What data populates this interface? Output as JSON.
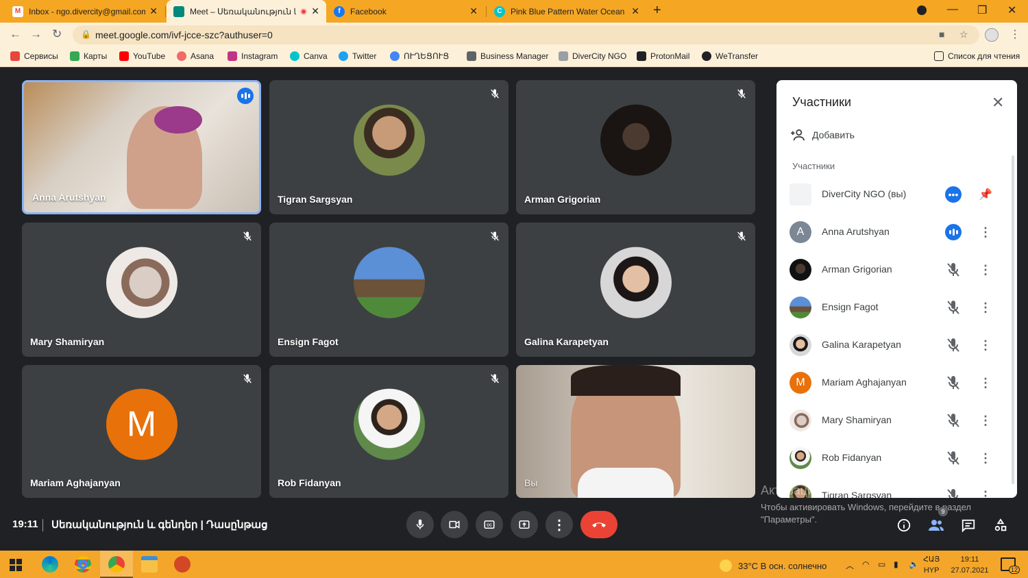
{
  "browser": {
    "tabs": [
      {
        "title": "Inbox - ngo.divercity@gmail.com",
        "favicon": "gmail-icon",
        "color": "#ea4335"
      },
      {
        "title": "Meet – Սեռականություն և",
        "favicon": "meet-icon",
        "color": "#00897b",
        "recording": true
      },
      {
        "title": "Facebook",
        "favicon": "facebook-icon",
        "color": "#1877f2"
      },
      {
        "title": "Pink Blue Pattern Water Ocean C",
        "favicon": "canva-icon",
        "color": "#00c4cc"
      }
    ],
    "url": "meet.google.com/ivf-jcce-szc?authuser=0",
    "bookmarks": [
      {
        "label": "Сервисы",
        "color": "#e8453c"
      },
      {
        "label": "Карты",
        "color": "#34a853"
      },
      {
        "label": "YouTube",
        "color": "#ff0000"
      },
      {
        "label": "Asana",
        "color": "#f06a6a"
      },
      {
        "label": "Instagram",
        "color": "#c13584"
      },
      {
        "label": "Canva",
        "color": "#00c4cc"
      },
      {
        "label": "Twitter",
        "color": "#1da1f2"
      },
      {
        "label": "ՈՒՂԵՑՈՒՑ",
        "color": "#4285f4"
      },
      {
        "label": "Business Manager",
        "color": "#5f6368"
      },
      {
        "label": "DiverCity NGO",
        "color": "#9aa0a6"
      },
      {
        "label": "ProtonMail",
        "color": "#202124"
      },
      {
        "label": "WeTransfer",
        "color": "#202124"
      }
    ],
    "reading_list": "Список для чтения"
  },
  "meet": {
    "tiles": [
      {
        "name": "Anna Arutshyan",
        "speaking": true
      },
      {
        "name": "Tigran Sargsyan"
      },
      {
        "name": "Arman Grigorian"
      },
      {
        "name": "Mary Shamiryan"
      },
      {
        "name": "Ensign Fagot"
      },
      {
        "name": "Galina Karapetyan"
      },
      {
        "name": "Mariam Aghajanyan",
        "initial": "M",
        "color": "#e8710a"
      },
      {
        "name": "Rob Fidanyan"
      },
      {
        "name": "Вы"
      }
    ],
    "clock": "19:11",
    "title": "Սեռականություն և գենդեր | Դասընթաց",
    "participants_count": "9"
  },
  "panel": {
    "title": "Участники",
    "add_label": "Добавить",
    "section_label": "Участники",
    "participants": [
      {
        "name": "DiverCity NGO (вы)",
        "status": "more-active"
      },
      {
        "name": "Anna Arutshyan",
        "initial": "A",
        "color": "#7b8794",
        "status": "speaking"
      },
      {
        "name": "Arman Grigorian",
        "status": "muted"
      },
      {
        "name": "Ensign Fagot",
        "status": "muted"
      },
      {
        "name": "Galina Karapetyan",
        "status": "muted"
      },
      {
        "name": "Mariam Aghajanyan",
        "initial": "M",
        "color": "#e8710a",
        "status": "muted"
      },
      {
        "name": "Mary Shamiryan",
        "status": "muted"
      },
      {
        "name": "Rob Fidanyan",
        "status": "muted"
      },
      {
        "name": "Tigran Sargsyan",
        "status": "muted"
      }
    ]
  },
  "windows": {
    "watermark_title": "Активация Windows",
    "watermark_text": "Чтобы активировать Windows, перейдите в раздел \"Параметры\".",
    "weather": "33°C  В осн. солнечно",
    "lang": "ՀԱՅ",
    "lang_sub": "HYP",
    "time": "19:11",
    "date": "27.07.2021",
    "notif_count": "12"
  }
}
